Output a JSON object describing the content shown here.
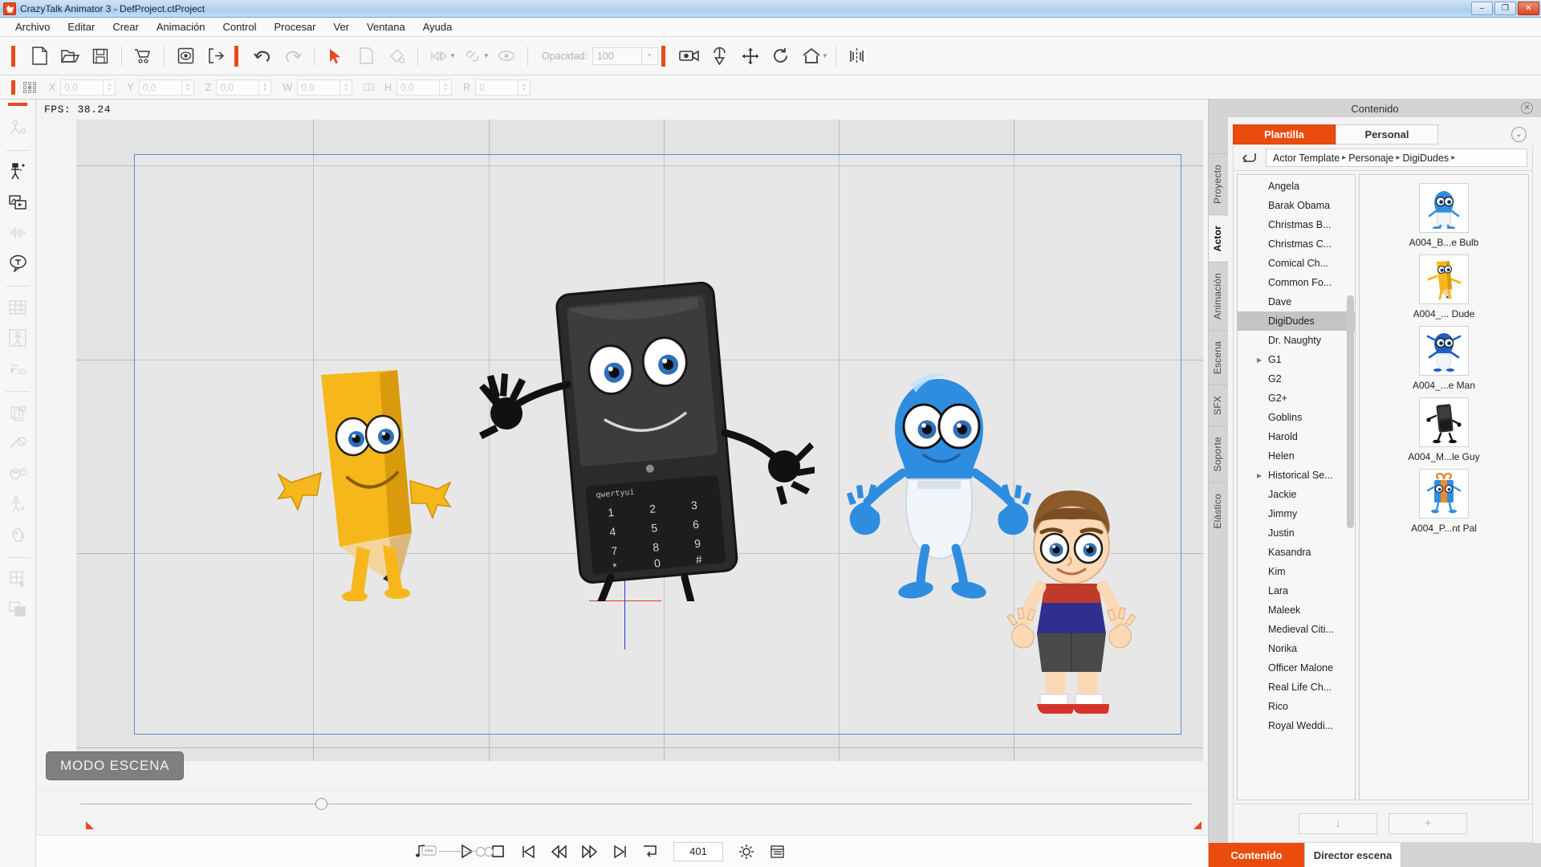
{
  "titlebar": {
    "app_name": "CrazyTalk Animator 3",
    "document": "- DefProject.ctProject",
    "title": "CrazyTalk Animator 3   - DefProject.ctProject",
    "minimize": "–",
    "maximize": "❐",
    "close": "✕"
  },
  "menu": {
    "items": [
      {
        "label": "Archivo"
      },
      {
        "label": "Editar"
      },
      {
        "label": "Crear"
      },
      {
        "label": "Animación"
      },
      {
        "label": "Control"
      },
      {
        "label": "Procesar"
      },
      {
        "label": "Ver"
      },
      {
        "label": "Ventana"
      },
      {
        "label": "Ayuda"
      }
    ]
  },
  "toolbar": {
    "opacity_label": "Opacidad:",
    "opacity_value": "100",
    "icons": [
      "new-document-icon",
      "open-folder-icon",
      "save-icon",
      "store-cart-icon",
      "preview-icon",
      "export-icon",
      "undo-icon",
      "redo-icon",
      "select-arrow-icon",
      "copy-icon",
      "fill-icon",
      "keyframe-icon",
      "link-icon",
      "eye-icon",
      "camera-icon",
      "pin-icon",
      "move-icon",
      "rotate-icon",
      "home-icon",
      "mirror-icon"
    ]
  },
  "propbar": {
    "fields": [
      {
        "label": "X",
        "value": "0,0"
      },
      {
        "label": "Y",
        "value": "0,0"
      },
      {
        "label": "Z",
        "value": "0,0"
      },
      {
        "label": "W",
        "value": "0,0"
      },
      {
        "label": "H",
        "value": "0,0"
      },
      {
        "label": "R",
        "value": "0"
      }
    ]
  },
  "lefttools": {
    "items": [
      {
        "name": "bone-rig-icon",
        "active": false
      },
      {
        "name": "actor-puppet-icon",
        "active": true
      },
      {
        "name": "media-image-icon",
        "active": true
      },
      {
        "name": "audio-wave-icon",
        "active": false
      },
      {
        "name": "text-bubble-icon",
        "active": true
      },
      {
        "name": "sprite-sheet-icon",
        "active": false
      },
      {
        "name": "body-pose-icon",
        "active": false
      },
      {
        "name": "three-d-icon",
        "active": false
      },
      {
        "name": "layers-icon",
        "active": false
      },
      {
        "name": "motion-key-icon",
        "active": false
      },
      {
        "name": "face-puppet-icon",
        "active": false
      },
      {
        "name": "body-puppet-icon",
        "active": false
      },
      {
        "name": "head-profile-icon",
        "active": false
      },
      {
        "name": "grid-select-icon",
        "active": false
      },
      {
        "name": "stack-layers-icon",
        "active": false
      }
    ]
  },
  "canvas": {
    "fps_label": "FPS: 38.24",
    "mode_badge": "MODO ESCENA",
    "characters": [
      {
        "name": "pencil-dude-character"
      },
      {
        "name": "mobile-guy-character"
      },
      {
        "name": "bulb-man-character"
      },
      {
        "name": "boy-character"
      }
    ]
  },
  "transport": {
    "frame_value": "401",
    "buttons": [
      {
        "name": "play-button",
        "glyph": "▷"
      },
      {
        "name": "stop-button",
        "glyph": "□"
      },
      {
        "name": "first-frame-button",
        "glyph": "⏮"
      },
      {
        "name": "prev-frame-button",
        "glyph": "⏪"
      },
      {
        "name": "next-frame-button",
        "glyph": "⏩"
      },
      {
        "name": "last-frame-button",
        "glyph": "⏭"
      },
      {
        "name": "loop-button",
        "glyph": "↴"
      }
    ],
    "settings_icon": "gear-icon",
    "timeline_icon": "timeline-icon",
    "bubble_icon": "speech-bubble-icon",
    "note_icon": "music-note-icon"
  },
  "rightpanel": {
    "header_title": "Contenido",
    "close_icon": "close-circle-icon",
    "collapse_icon": "chevron-down-circle-icon",
    "vertical_tabs": [
      {
        "label": "Proyecto",
        "active": false
      },
      {
        "label": "Actor",
        "active": true
      },
      {
        "label": "Animación",
        "active": false
      },
      {
        "label": "Escena",
        "active": false
      },
      {
        "label": "SFX",
        "active": false
      },
      {
        "label": "Soporte",
        "active": false
      },
      {
        "label": "Elástico",
        "active": false
      }
    ],
    "tabs": [
      {
        "label": "Plantilla",
        "active": true
      },
      {
        "label": "Personal",
        "active": false
      }
    ],
    "breadcrumb": [
      {
        "label": "Actor Template"
      },
      {
        "label": "Personaje"
      },
      {
        "label": "DigiDudes"
      }
    ],
    "breadcrumb_arrow": "▸",
    "back_icon": "back-arrow-icon",
    "categories": [
      {
        "label": "Angela",
        "selected": false,
        "expandable": false
      },
      {
        "label": "Barak Obama",
        "selected": false,
        "expandable": false
      },
      {
        "label": "Christmas B...",
        "selected": false,
        "expandable": false
      },
      {
        "label": "Christmas C...",
        "selected": false,
        "expandable": false
      },
      {
        "label": "Comical Ch...",
        "selected": false,
        "expandable": false
      },
      {
        "label": "Common Fo...",
        "selected": false,
        "expandable": false
      },
      {
        "label": "Dave",
        "selected": false,
        "expandable": false
      },
      {
        "label": "DigiDudes",
        "selected": true,
        "expandable": false
      },
      {
        "label": "Dr. Naughty",
        "selected": false,
        "expandable": false
      },
      {
        "label": "G1",
        "selected": false,
        "expandable": true
      },
      {
        "label": "G2",
        "selected": false,
        "expandable": false
      },
      {
        "label": "G2+",
        "selected": false,
        "expandable": false
      },
      {
        "label": "Goblins",
        "selected": false,
        "expandable": false
      },
      {
        "label": "Harold",
        "selected": false,
        "expandable": false
      },
      {
        "label": "Helen",
        "selected": false,
        "expandable": false
      },
      {
        "label": "Historical Se...",
        "selected": false,
        "expandable": true
      },
      {
        "label": "Jackie",
        "selected": false,
        "expandable": false
      },
      {
        "label": "Jimmy",
        "selected": false,
        "expandable": false
      },
      {
        "label": "Justin",
        "selected": false,
        "expandable": false
      },
      {
        "label": "Kasandra",
        "selected": false,
        "expandable": false
      },
      {
        "label": "Kim",
        "selected": false,
        "expandable": false
      },
      {
        "label": "Lara",
        "selected": false,
        "expandable": false
      },
      {
        "label": "Maleek",
        "selected": false,
        "expandable": false
      },
      {
        "label": "Medieval Citi...",
        "selected": false,
        "expandable": false
      },
      {
        "label": "Norika",
        "selected": false,
        "expandable": false
      },
      {
        "label": "Officer Malone",
        "selected": false,
        "expandable": false
      },
      {
        "label": "Real Life Ch...",
        "selected": false,
        "expandable": false
      },
      {
        "label": "Rico",
        "selected": false,
        "expandable": false
      },
      {
        "label": "Royal Weddi...",
        "selected": false,
        "expandable": false
      }
    ],
    "thumbnails": [
      {
        "label": "A004_B...e Bulb",
        "icon": "bulb-character-thumb"
      },
      {
        "label": "A004_... Dude",
        "icon": "pencil-character-thumb"
      },
      {
        "label": "A004_...e Man",
        "icon": "man-character-thumb"
      },
      {
        "label": "A004_M...le Guy",
        "icon": "mobile-character-thumb"
      },
      {
        "label": "A004_P...nt Pal",
        "icon": "present-character-thumb"
      }
    ],
    "footer_buttons": [
      {
        "label": "↓",
        "name": "download-button"
      },
      {
        "label": "+",
        "name": "add-button"
      }
    ],
    "bottom_tabs": [
      {
        "label": "Contenido",
        "active": true
      },
      {
        "label": "Director escena",
        "active": false
      }
    ]
  },
  "colors": {
    "accent": "#ea4c0d",
    "accent_bar": "#e8491d",
    "titlebar_blue": "#b9d6f2",
    "panel_gray": "#d4d4d4",
    "canvas_gray": "#e3e3e3",
    "safe_border": "#5b8fc9"
  }
}
